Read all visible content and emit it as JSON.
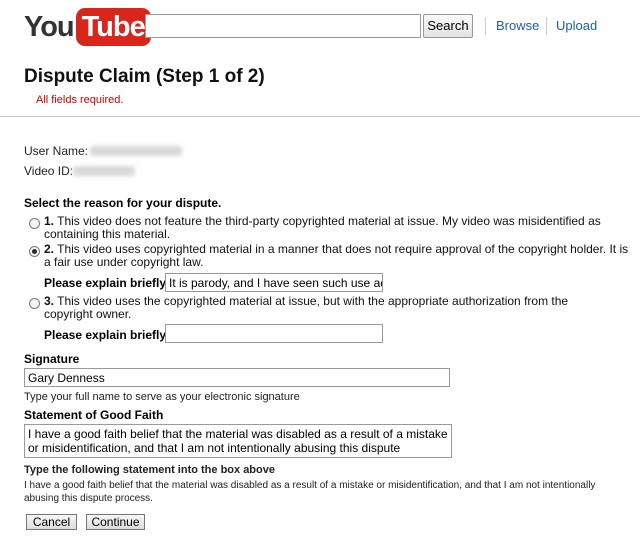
{
  "header": {
    "logo_left": "You",
    "logo_right": "Tube",
    "search_placeholder": "",
    "search_button": "Search",
    "nav": [
      "Browse",
      "Upload"
    ],
    "colors": {
      "logo_red": "#d9261c",
      "link": "#1c5ea6",
      "required": "#cc0000"
    }
  },
  "page": {
    "title": "Dispute Claim (Step 1 of 2)",
    "required_note": "All fields required."
  },
  "info": {
    "user_name_label": "User Name:",
    "video_id_label": "Video ID:"
  },
  "reason": {
    "heading": "Select the reason for your dispute.",
    "options": [
      {
        "number": "1.",
        "text": "This video does not feature the third-party copyrighted material at issue. My video was misidentified as containing this material.",
        "selected": false
      },
      {
        "number": "2.",
        "text": "This video uses copyrighted material in a manner that does not require approval of the copyright holder. It is a fair use under copyright law.",
        "selected": true
      },
      {
        "number": "3.",
        "text": "This video uses the copyrighted material at issue, but with the appropriate authorization from the copyright owner.",
        "selected": false
      }
    ],
    "explain_label": "Please explain briefly:",
    "explain_value_2": "It is parody, and I have seen such use acc",
    "explain_value_3": ""
  },
  "signature": {
    "label": "Signature",
    "value": "Gary Denness",
    "help": "Type your full name to serve as your electronic signature"
  },
  "good_faith": {
    "label": "Statement of Good Faith",
    "value": "I have a good faith belief that the material was disabled as a result of a mistake or misidentification, and that I am not intentionally abusing this dispute process.",
    "instruction": "Type the following statement into the box above",
    "statement": "I have a good faith belief that the material was disabled as a result of a mistake or misidentification, and that I am not intentionally abusing this dispute process."
  },
  "actions": {
    "cancel": "Cancel",
    "continue": "Continue"
  }
}
